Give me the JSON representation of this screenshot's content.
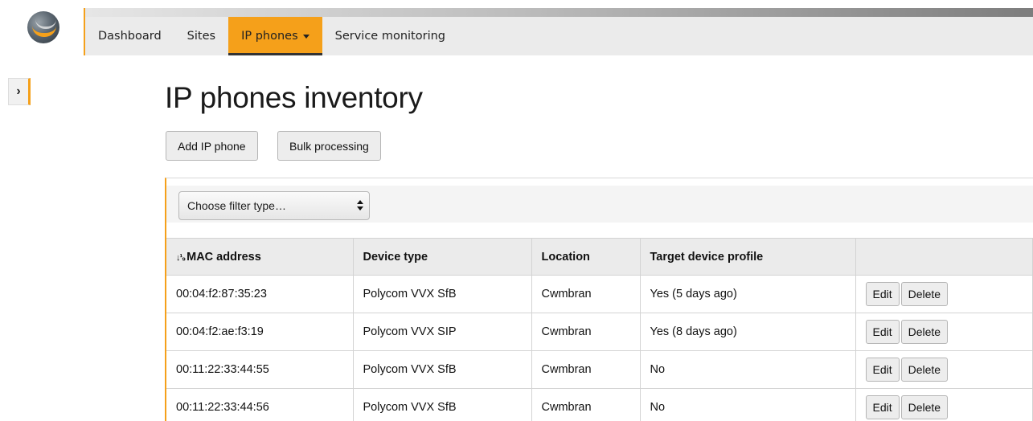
{
  "nav": {
    "items": [
      {
        "label": "Dashboard"
      },
      {
        "label": "Sites"
      },
      {
        "label": "IP phones"
      },
      {
        "label": "Service monitoring"
      }
    ]
  },
  "page": {
    "title": "IP phones inventory",
    "add_label": "Add IP phone",
    "bulk_label": "Bulk processing"
  },
  "filter": {
    "selected": "Choose filter type…"
  },
  "table": {
    "columns": [
      "MAC address",
      "Device type",
      "Location",
      "Target device profile"
    ],
    "sort_column": "MAC address",
    "rows": [
      {
        "mac": "00:04:f2:87:35:23",
        "device": "Polycom VVX SfB",
        "location": "Cwmbran",
        "profile": "Yes (5 days ago)"
      },
      {
        "mac": "00:04:f2:ae:f3:19",
        "device": "Polycom VVX SIP",
        "location": "Cwmbran",
        "profile": "Yes (8 days ago)"
      },
      {
        "mac": "00:11:22:33:44:55",
        "device": "Polycom VVX SfB",
        "location": "Cwmbran",
        "profile": "No"
      },
      {
        "mac": "00:11:22:33:44:56",
        "device": "Polycom VVX SfB",
        "location": "Cwmbran",
        "profile": "No"
      }
    ],
    "edit_label": "Edit",
    "delete_label": "Delete"
  },
  "theme": {
    "accent": "#f5a01a",
    "navbar_bg": "#ebebeb"
  }
}
